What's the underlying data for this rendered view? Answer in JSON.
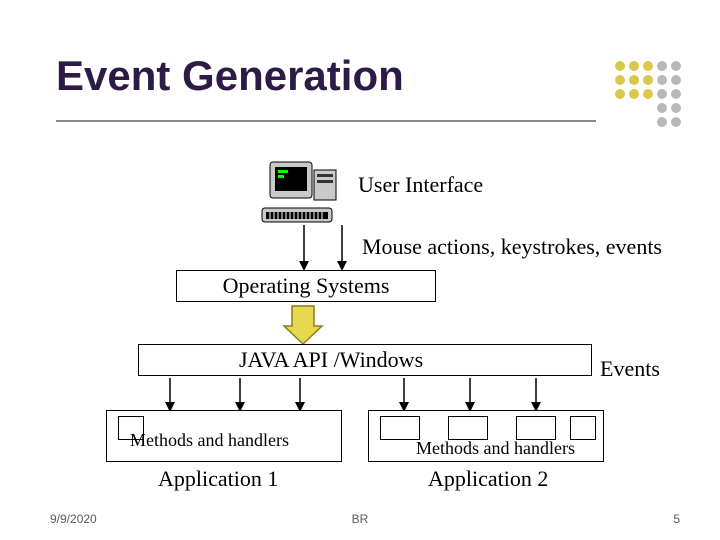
{
  "title": "Event Generation",
  "labels": {
    "ui": "User Interface",
    "mouse": "Mouse actions, keystrokes, events",
    "os": "Operating Systems",
    "java": "JAVA API /Windows",
    "events": "Events",
    "mh1": "Methods and handlers",
    "mh2": "Methods and handlers",
    "app1": "Application 1",
    "app2": "Application 2"
  },
  "footer": {
    "date": "9/9/2020",
    "center": "BR",
    "page": "5"
  },
  "colors": {
    "dot_yellow": "#d9c84a",
    "dot_grey": "#b9b9b9",
    "arrow_fill": "#e7d94f",
    "title": "#2e1a47"
  }
}
